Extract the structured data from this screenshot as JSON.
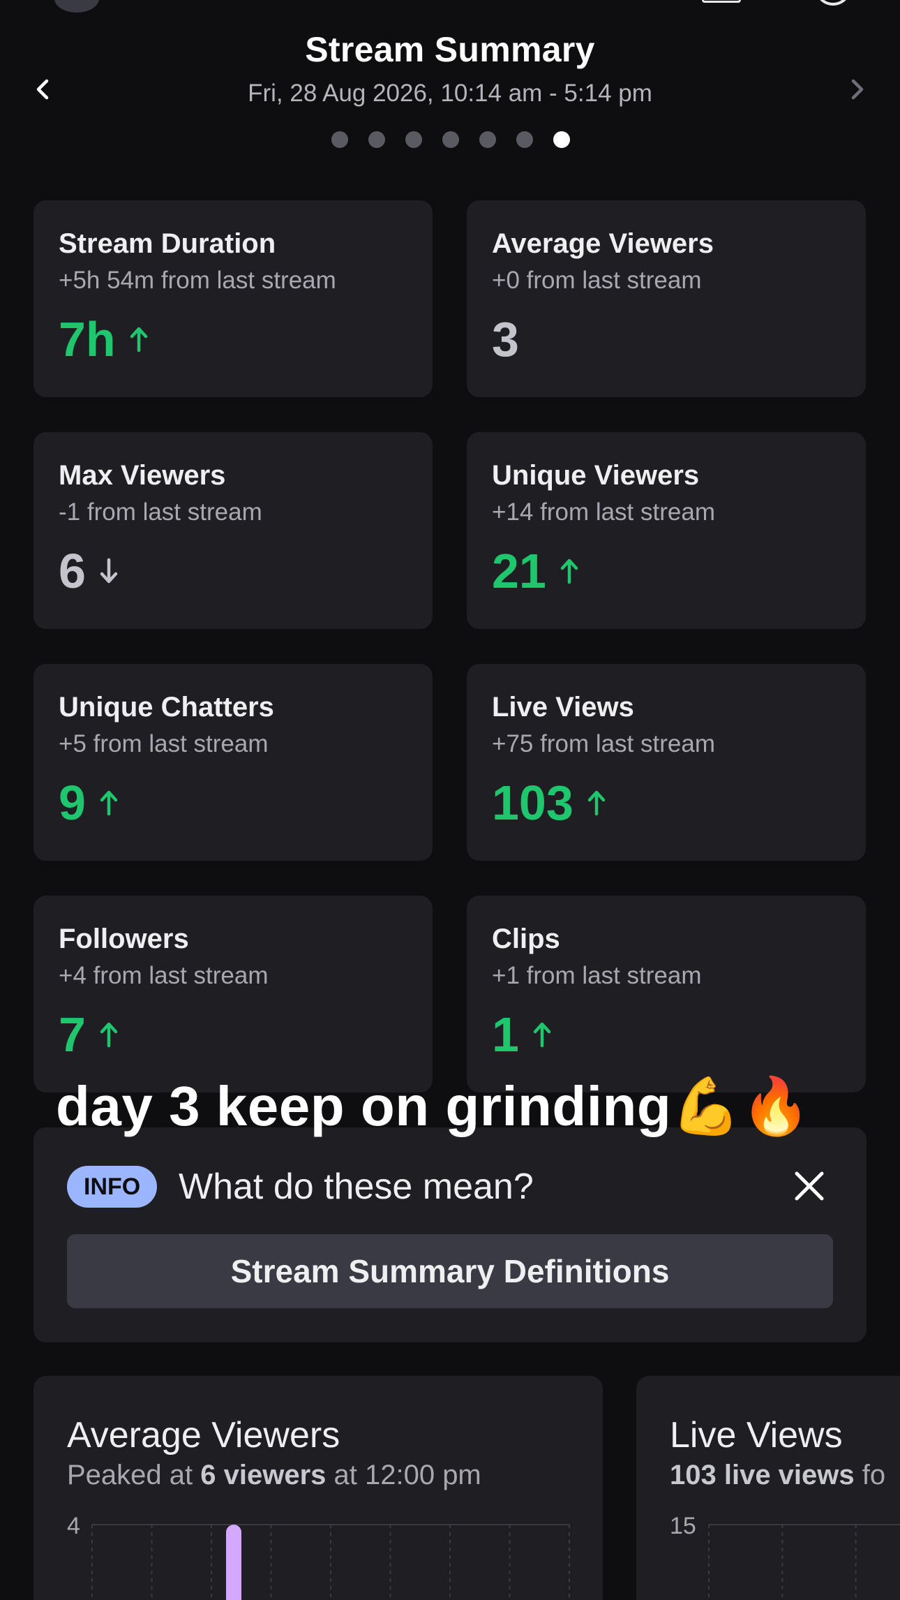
{
  "header": {
    "title": "Stream Summary",
    "date_range": "Fri, 28 Aug 2026, 10:14 am - 5:14 pm",
    "page_count": 7,
    "active_page_index": 6
  },
  "icons": {
    "prev": "chevron-left-icon",
    "next": "chevron-right-icon",
    "up": "arrow-up-icon",
    "down": "arrow-down-icon",
    "close": "close-icon"
  },
  "colors": {
    "positive": "#1fc66d",
    "neutral": "#c4c4cc",
    "info_badge": "#9bb5ff",
    "chart_bar": "#d4a8ff"
  },
  "stats": [
    {
      "title": "Stream Duration",
      "delta": "+5h 54m from last stream",
      "value": "7h",
      "trend": "up"
    },
    {
      "title": "Average Viewers",
      "delta": "+0 from last stream",
      "value": "3",
      "trend": "flat"
    },
    {
      "title": "Max Viewers",
      "delta": "-1 from last stream",
      "value": "6",
      "trend": "down"
    },
    {
      "title": "Unique Viewers",
      "delta": "+14 from last stream",
      "value": "21",
      "trend": "up"
    },
    {
      "title": "Unique Chatters",
      "delta": "+5 from last stream",
      "value": "9",
      "trend": "up"
    },
    {
      "title": "Live Views",
      "delta": "+75 from last stream",
      "value": "103",
      "trend": "up"
    },
    {
      "title": "Followers",
      "delta": "+4 from last stream",
      "value": "7",
      "trend": "up"
    },
    {
      "title": "Clips",
      "delta": "+1 from last stream",
      "value": "1",
      "trend": "up"
    }
  ],
  "caption": "day 3 keep on grinding💪🔥",
  "info": {
    "badge": "INFO",
    "question": "What do these mean?",
    "button_label": "Stream Summary Definitions"
  },
  "charts": [
    {
      "title": "Average Viewers",
      "sub_prefix": "Peaked at ",
      "sub_bold": "6 viewers",
      "sub_suffix": " at 12:00 pm",
      "y_top_tick": "4"
    },
    {
      "title": "Live Views",
      "sub_bold": "103 live views",
      "sub_suffix": " fo",
      "y_top_tick": "15"
    }
  ]
}
